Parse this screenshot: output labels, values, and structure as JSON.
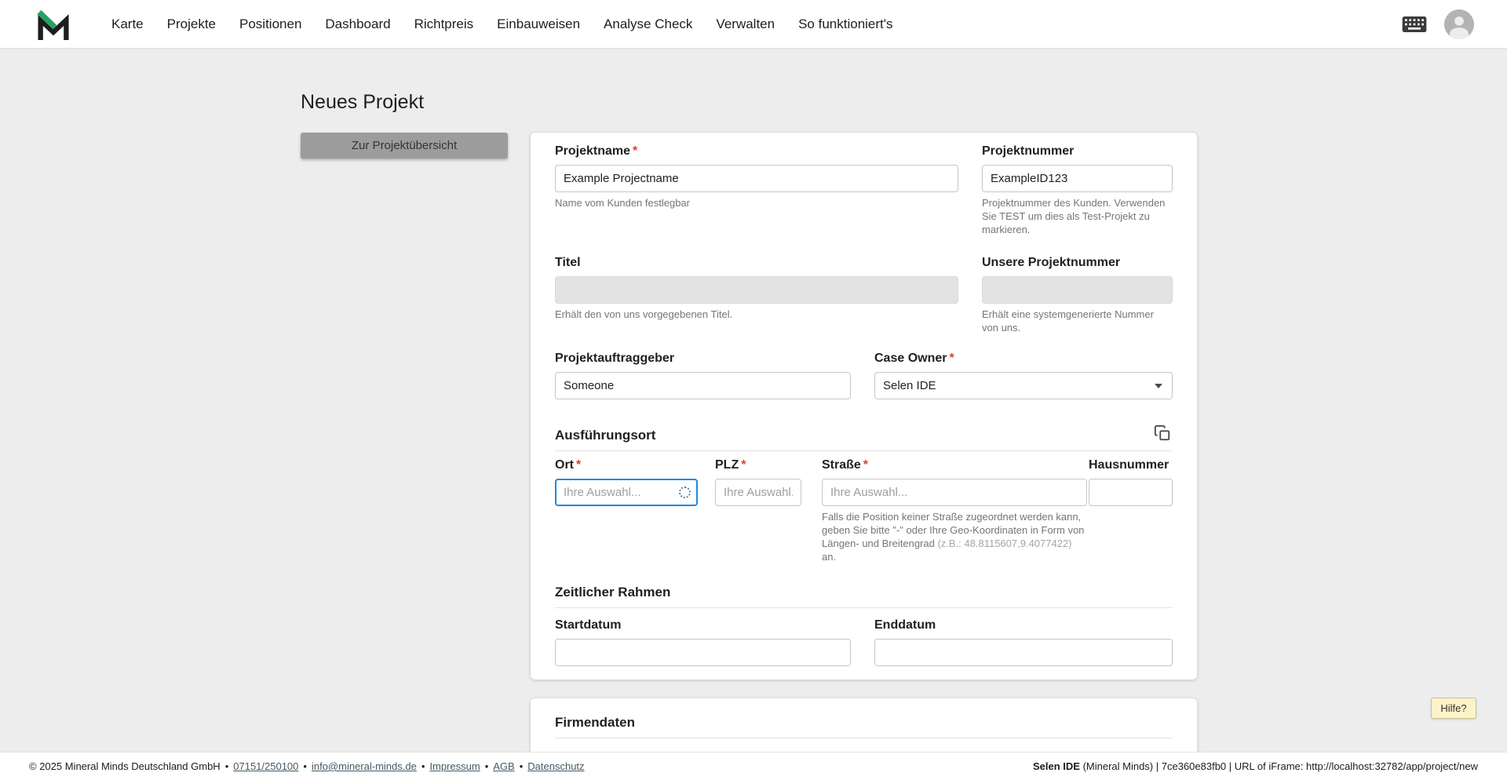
{
  "nav": {
    "items": [
      "Karte",
      "Projekte",
      "Positionen",
      "Dashboard",
      "Richtpreis",
      "Einbauweisen",
      "Analyse Check",
      "Verwalten",
      "So funktioniert's"
    ]
  },
  "page": {
    "title": "Neues Projekt",
    "back_button_label": "Zur Projektübersicht",
    "help_button_label": "Hilfe?"
  },
  "form": {
    "required_marker": "*",
    "projektname": {
      "label": "Projektname",
      "value": "Example Projectname",
      "helper": "Name vom Kunden festlegbar"
    },
    "projektnummer": {
      "label": "Projektnummer",
      "value": "ExampleID123",
      "helper": "Projektnummer des Kunden. Verwenden Sie TEST um dies als Test-Projekt zu markieren."
    },
    "titel": {
      "label": "Titel",
      "value": "",
      "helper": "Erhält den von uns vorgegebenen Titel."
    },
    "unsere_projektnummer": {
      "label": "Unsere Projektnummer",
      "value": "",
      "helper": "Erhält eine systemgenerierte Nummer von uns."
    },
    "projektauftraggeber": {
      "label": "Projektauftraggeber",
      "value": "Someone"
    },
    "case_owner": {
      "label": "Case Owner",
      "value": "Selen IDE"
    },
    "sections": {
      "ausfuehrungsort": "Ausführungsort",
      "zeitlicher_rahmen": "Zeitlicher Rahmen",
      "firmendaten": "Firmendaten"
    },
    "ort": {
      "label": "Ort",
      "placeholder": "Ihre Auswahl..."
    },
    "plz": {
      "label": "PLZ",
      "placeholder": "Ihre Auswahl."
    },
    "strasse": {
      "label": "Straße",
      "placeholder": "Ihre Auswahl...",
      "helper_main": "Falls die Position keiner Straße zugeordnet werden kann, geben Sie bitte \"-\" oder Ihre Geo-Koordinaten in Form von Längen- und Breitengrad ",
      "helper_example": "(z.B.: 48.8115607,9.4077422)",
      "helper_suffix": " an."
    },
    "hausnummer": {
      "label": "Hausnummer",
      "value": ""
    },
    "startdatum": {
      "label": "Startdatum",
      "value": ""
    },
    "enddatum": {
      "label": "Enddatum",
      "value": ""
    }
  },
  "footer": {
    "copyright": "© 2025 Mineral Minds Deutschland GmbH",
    "separator": "•",
    "phone": "07151/250100",
    "email": "info@mineral-minds.de",
    "links": [
      "Impressum",
      "AGB",
      "Datenschutz"
    ],
    "session_user": "Selen IDE",
    "session_rest": " (Mineral Minds) | 7ce360e83fb0 | URL of iFrame: http://localhost:32782/app/project/new"
  },
  "icons": {
    "logo": "mineral-minds-logo",
    "nav_right": [
      "keyboard-icon",
      "account-circle-icon"
    ],
    "location_copy": "content-copy-icon",
    "ort_loading": "spinner-icon",
    "case_owner": "caret-down-icon"
  },
  "colors": {
    "accent_green": "#27a163",
    "focus_blue": "#1e88e5",
    "required_red": "#e53935",
    "page_background": "#ededed"
  }
}
